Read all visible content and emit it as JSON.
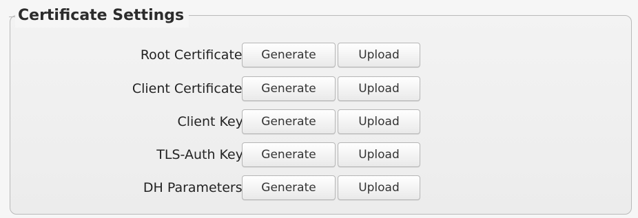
{
  "fieldset": {
    "legend": "Certificate Settings"
  },
  "rows": [
    {
      "label": "Root Certificate:",
      "generate_label": "Generate",
      "upload_label": "Upload"
    },
    {
      "label": "Client Certificate:",
      "generate_label": "Generate",
      "upload_label": "Upload"
    },
    {
      "label": "Client Key:",
      "generate_label": "Generate",
      "upload_label": "Upload"
    },
    {
      "label": "TLS-Auth Key:",
      "generate_label": "Generate",
      "upload_label": "Upload"
    },
    {
      "label": "DH Parameters:",
      "generate_label": "Generate",
      "upload_label": "Upload"
    }
  ]
}
